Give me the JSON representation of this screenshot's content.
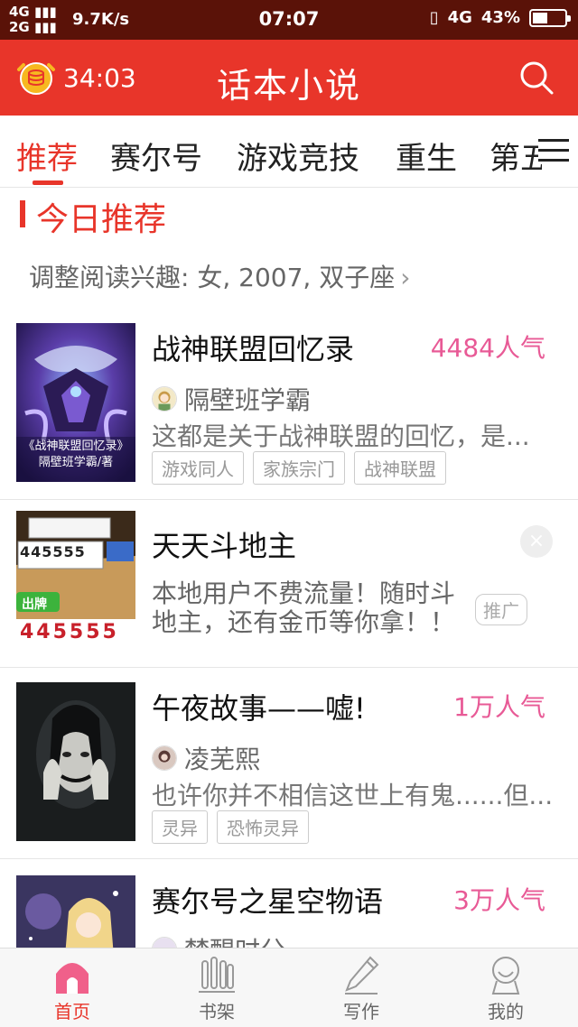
{
  "status_bar": {
    "network_1": "4G",
    "network_2": "2G",
    "speed": "9.7K/s",
    "time": "07:07",
    "network_right": "4G",
    "battery_percent": "43%",
    "battery_level": 0.43
  },
  "header": {
    "timer": "34:03",
    "title": "话本小说"
  },
  "tabs": [
    {
      "label": "推荐",
      "active": true
    },
    {
      "label": "赛尔号"
    },
    {
      "label": "游戏竞技"
    },
    {
      "label": "重生"
    },
    {
      "label": "第五"
    }
  ],
  "section": {
    "title": "今日推荐",
    "interest": "调整阅读兴趣: 女, 2007, 双子座",
    "chevron": "›"
  },
  "items": [
    {
      "title": "战神联盟回忆录",
      "popularity": "4484人气",
      "author": "隔壁班学霸",
      "description": "这都是关于战神联盟的回忆，是...",
      "tags": [
        "游戏同人",
        "家族宗门",
        "战神联盟"
      ],
      "cover_text_1": "《战神联盟回忆录》",
      "cover_text_2": "隔壁班学霸/著"
    },
    {
      "title": "天天斗地主",
      "description": "本地用户不费流量！随时斗地主，还有金币等你拿！！",
      "badge": "推广",
      "close": "×",
      "cover_button": "出牌",
      "cover_cards": "445555"
    },
    {
      "title": "午夜故事——嘘!",
      "popularity": "1万人气",
      "author": "凌芜熙",
      "description": "也许你并不相信这世上有鬼......但...",
      "tags": [
        "灵异",
        "恐怖灵异"
      ]
    },
    {
      "title": "赛尔号之星空物语",
      "popularity": "3万人气",
      "author": "梦醒时分"
    }
  ],
  "bottom_nav": [
    {
      "label": "首页",
      "active": true
    },
    {
      "label": "书架"
    },
    {
      "label": "写作"
    },
    {
      "label": "我的"
    }
  ],
  "colors": {
    "brand_red": "#e8352a",
    "popularity_pink": "#e85a96",
    "status_bar": "#5a1208"
  }
}
